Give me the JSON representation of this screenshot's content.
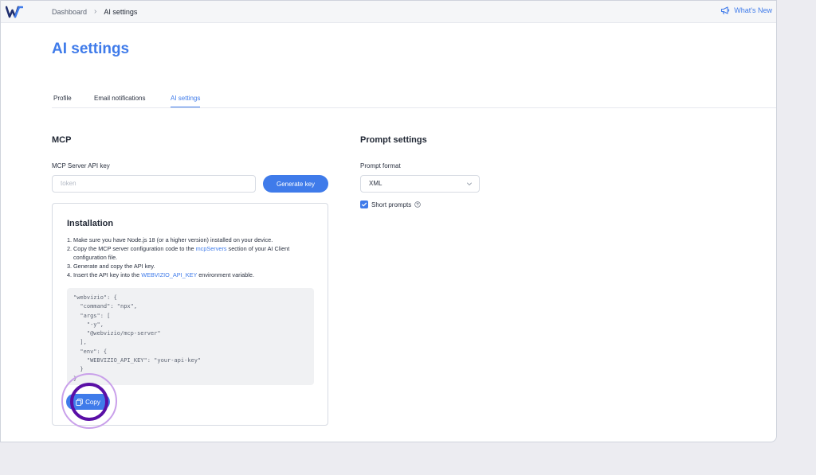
{
  "topbar": {
    "breadcrumb": [
      "Dashboard",
      "AI settings"
    ],
    "whats_new": "What's New",
    "logo_icon": "webvizio-logo-icon",
    "whats_new_icon": "megaphone-icon"
  },
  "page": {
    "title": "AI settings"
  },
  "tabs": [
    {
      "label": "Profile",
      "active": false
    },
    {
      "label": "Email notifications",
      "active": false
    },
    {
      "label": "AI settings",
      "active": true
    }
  ],
  "mcp": {
    "title": "MCP",
    "api_key_label": "MCP Server API key",
    "api_key_placeholder": "token",
    "generate_label": "Generate key",
    "installation": {
      "title": "Installation",
      "steps": [
        {
          "num": "1.",
          "text": "Make sure you have Node.js 18 (or a higher version) installed on your device."
        },
        {
          "num": "2.",
          "pre": "Copy the MCP server configuration code to the ",
          "link": "mcpServers",
          "post": " section of your AI Client configuration file."
        },
        {
          "num": "3.",
          "text": "Generate and copy the API key."
        },
        {
          "num": "4.",
          "pre": "Insert the API key into the ",
          "link": "WEBVIZIO_API_KEY",
          "post": " environment variable."
        }
      ],
      "code": "\"webvizio\": {\n  \"command\": \"npx\",\n  \"args\": [\n    \"-y\",\n    \"@webvizio/mcp-server\"\n  ],\n  \"env\": {\n    \"WEBVIZIO_API_KEY\": \"your-api-key\"\n  }\n}",
      "copy_label": "Copy"
    }
  },
  "prompt": {
    "title": "Prompt settings",
    "format_label": "Prompt format",
    "format_value": "XML",
    "short_prompts_label": "Short prompts",
    "short_prompts_checked": true
  },
  "colors": {
    "accent": "#3f7bea",
    "highlight": "#5a0fa6"
  }
}
